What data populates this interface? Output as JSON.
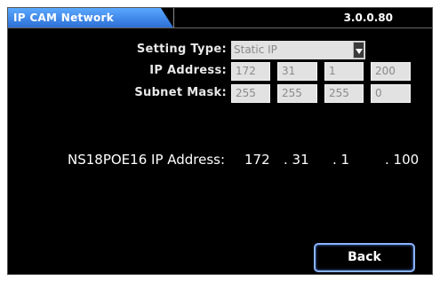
{
  "window": {
    "title": "IP CAM Network",
    "version": "3.0.0.80"
  },
  "form": {
    "setting_type_label": "Setting Type:",
    "setting_type_value": "Static IP",
    "ip_label": "IP Address:",
    "ip": [
      "172",
      "31",
      "1",
      "200"
    ],
    "mask_label": "Subnet Mask:",
    "mask": [
      "255",
      "255",
      "255",
      "0"
    ]
  },
  "device": {
    "label": "NS18POE16 IP Address:",
    "ip": [
      "172",
      ". 31",
      ". 1",
      ". 100"
    ]
  },
  "buttons": {
    "back": "Back"
  }
}
